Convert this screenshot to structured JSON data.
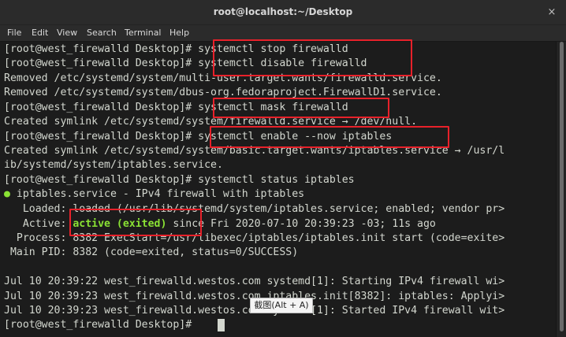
{
  "window": {
    "title": "root@localhost:~/Desktop",
    "close_label": "×"
  },
  "menu": [
    "File",
    "Edit",
    "View",
    "Search",
    "Terminal",
    "Help"
  ],
  "terminal": {
    "lines": [
      [
        {
          "t": "[root@west_firewalld Desktop]# systemctl stop firewalld"
        }
      ],
      [
        {
          "t": "[root@west_firewalld Desktop]# systemctl disable firewalld"
        }
      ],
      [
        {
          "t": "Removed /etc/systemd/system/multi-user.target.wants/firewalld.service."
        }
      ],
      [
        {
          "t": "Removed /etc/systemd/system/dbus-org.fedoraproject.FirewallD1.service."
        }
      ],
      [
        {
          "t": "[root@west_firewalld Desktop]# systemctl mask firewalld"
        }
      ],
      [
        {
          "t": "Created symlink /etc/systemd/system/firewalld.service → /dev/null."
        }
      ],
      [
        {
          "t": "[root@west_firewalld Desktop]# systemctl enable --now iptables"
        }
      ],
      [
        {
          "t": "Created symlink /etc/systemd/system/basic.target.wants/iptables.service → /usr/l"
        }
      ],
      [
        {
          "t": "ib/systemd/system/iptables.service."
        }
      ],
      [
        {
          "t": "[root@west_firewalld Desktop]# systemctl status iptables"
        }
      ],
      [
        {
          "t": "●",
          "c": "dot"
        },
        {
          "t": " iptables.service - IPv4 firewall with iptables"
        }
      ],
      [
        {
          "t": "   Loaded: loaded (/usr/lib/systemd/system/iptables.service; enabled; vendor pr>"
        }
      ],
      [
        {
          "t": "   Active: "
        },
        {
          "t": "active (exited)",
          "c": "green"
        },
        {
          "t": " since Fri 2020-07-10 20:39:23 -03; 11s ago"
        }
      ],
      [
        {
          "t": "  Process: 8382 ExecStart=/usr/libexec/iptables/iptables.init start (code=exite>"
        }
      ],
      [
        {
          "t": " Main PID: 8382 (code=exited, status=0/SUCCESS)"
        }
      ],
      [
        {
          "t": ""
        }
      ],
      [
        {
          "t": "Jul 10 20:39:22 west_firewalld.westos.com systemd[1]: Starting IPv4 firewall wi>"
        }
      ],
      [
        {
          "t": "Jul 10 20:39:23 west_firewalld.westos.com iptables.init[8382]: iptables: Applyi>"
        }
      ],
      [
        {
          "t": "Jul 10 20:39:23 west_firewalld.westos.com systemd[1]: Started IPv4 firewall wit>"
        }
      ],
      [
        {
          "t": "[root@west_firewalld Desktop]# "
        }
      ]
    ]
  },
  "tooltip": "截图(Alt + A)",
  "colors": {
    "highlight": "#e8212a",
    "active_green": "#8ae234",
    "text": "#d3d7cf",
    "background": "#1c1c1c"
  }
}
